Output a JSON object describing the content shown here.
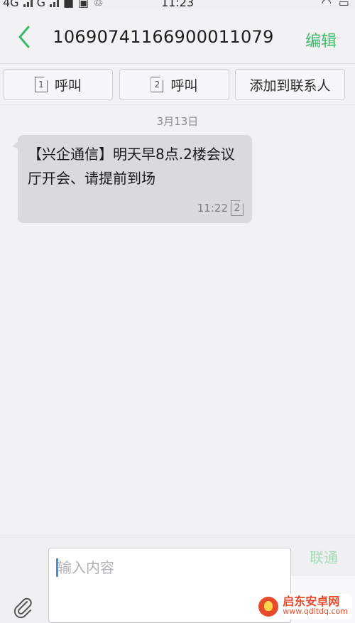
{
  "statusbar": {
    "left": "4G",
    "carrier2": "G",
    "time": "11:23"
  },
  "header": {
    "title": "10690741166900011079",
    "edit_label": "编辑"
  },
  "actions": [
    {
      "sim": "1",
      "label": "呼叫"
    },
    {
      "sim": "2",
      "label": "呼叫"
    },
    {
      "label": "添加到联系人"
    }
  ],
  "messages": {
    "date": "3月13日",
    "items": [
      {
        "text": "【兴企通信】明天早8点.2楼会议厅开会、请提前到场",
        "time": "11:22",
        "sim": "2"
      }
    ]
  },
  "composer": {
    "placeholder": "输入内容",
    "value": "",
    "carrier_label": "联通"
  },
  "watermark": {
    "title": "启东安卓网",
    "url": "www.qdltdq.com"
  },
  "colors": {
    "accent": "#3cb96b",
    "bubble": "#d9d9de",
    "background": "#f2f1f4"
  }
}
